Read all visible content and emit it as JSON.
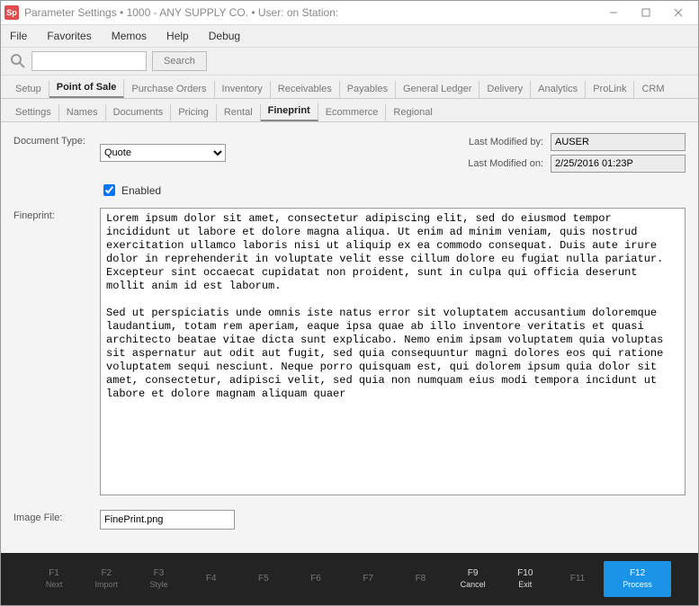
{
  "window": {
    "app_icon_text": "Sp",
    "title": "Parameter Settings   •   1000 - ANY SUPPLY CO.   •   User:              on Station:"
  },
  "menu": {
    "file": "File",
    "favorites": "Favorites",
    "memos": "Memos",
    "help": "Help",
    "debug": "Debug"
  },
  "toolbar": {
    "search_placeholder": "",
    "search_btn": "Search"
  },
  "tabs_primary": {
    "setup": "Setup",
    "pos": "Point of Sale",
    "po": "Purchase Orders",
    "inv": "Inventory",
    "recv": "Receivables",
    "pay": "Payables",
    "gl": "General Ledger",
    "deliv": "Delivery",
    "analytics": "Analytics",
    "prolink": "ProLink",
    "crm": "CRM"
  },
  "tabs_secondary": {
    "settings": "Settings",
    "names": "Names",
    "documents": "Documents",
    "pricing": "Pricing",
    "rental": "Rental",
    "fineprint": "Fineprint",
    "ecommerce": "Ecommerce",
    "regional": "Regional"
  },
  "form": {
    "doc_type_label": "Document Type:",
    "doc_type_value": "Quote",
    "enabled_label": "Enabled",
    "enabled_checked": true,
    "last_mod_by_label": "Last Modified by:",
    "last_mod_by_value": "AUSER",
    "last_mod_on_label": "Last Modified on:",
    "last_mod_on_value": "2/25/2016 01:23P",
    "fineprint_label": "Fineprint:",
    "fineprint_text": "Lorem ipsum dolor sit amet, consectetur adipiscing elit, sed do eiusmod tempor incididunt ut labore et dolore magna aliqua. Ut enim ad minim veniam, quis nostrud exercitation ullamco laboris nisi ut aliquip ex ea commodo consequat. Duis aute irure dolor in reprehenderit in voluptate velit esse cillum dolore eu fugiat nulla pariatur. Excepteur sint occaecat cupidatat non proident, sunt in culpa qui officia deserunt mollit anim id est laborum.\n\nSed ut perspiciatis unde omnis iste natus error sit voluptatem accusantium doloremque laudantium, totam rem aperiam, eaque ipsa quae ab illo inventore veritatis et quasi architecto beatae vitae dicta sunt explicabo. Nemo enim ipsam voluptatem quia voluptas sit aspernatur aut odit aut fugit, sed quia consequuntur magni dolores eos qui ratione voluptatem sequi nesciunt. Neque porro quisquam est, qui dolorem ipsum quia dolor sit amet, consectetur, adipisci velit, sed quia non numquam eius modi tempora incidunt ut labore et dolore magnam aliquam quaer",
    "image_file_label": "Image File:",
    "image_file_value": "FinePrint.png"
  },
  "footer": {
    "f1": {
      "k": "F1",
      "t": "Next"
    },
    "f2": {
      "k": "F2",
      "t": "Import"
    },
    "f3": {
      "k": "F3",
      "t": "Style"
    },
    "f4": {
      "k": "F4",
      "t": ""
    },
    "f5": {
      "k": "F5",
      "t": ""
    },
    "f6": {
      "k": "F6",
      "t": ""
    },
    "f7": {
      "k": "F7",
      "t": ""
    },
    "f8": {
      "k": "F8",
      "t": ""
    },
    "f9": {
      "k": "F9",
      "t": "Cancel"
    },
    "f10": {
      "k": "F10",
      "t": "Exit"
    },
    "f11": {
      "k": "F11",
      "t": ""
    },
    "f12": {
      "k": "F12",
      "t": "Process"
    }
  }
}
